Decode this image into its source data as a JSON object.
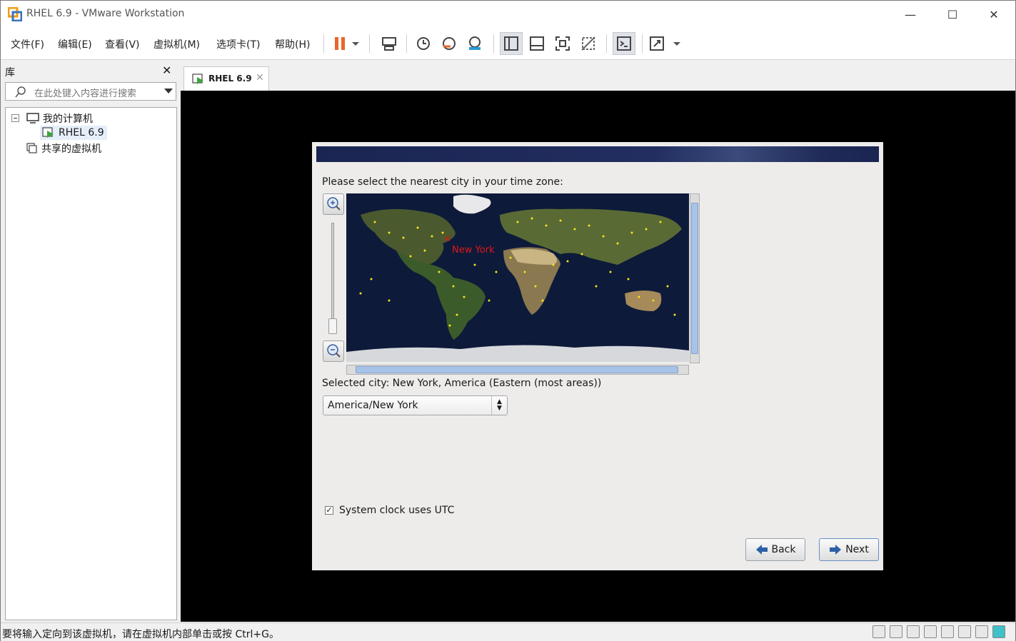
{
  "window": {
    "title": "RHEL 6.9 - VMware Workstation"
  },
  "menu": [
    "文件(F)",
    "编辑(E)",
    "查看(V)",
    "虚拟机(M)",
    "选项卡(T)",
    "帮助(H)"
  ],
  "library": {
    "title": "库",
    "search_placeholder": "在此处键入内容进行搜索",
    "tree": {
      "my_computer": "我的计算机",
      "vm": "RHEL 6.9",
      "shared": "共享的虚拟机"
    }
  },
  "tab": {
    "label": "RHEL 6.9"
  },
  "installer": {
    "prompt": "Please select the nearest city in your time zone:",
    "map_marker_label": "New York",
    "selected_city": "Selected city: New York, America (Eastern (most areas))",
    "timezone_value": "America/New York",
    "utc_label": "System clock uses UTC",
    "utc_checked": true,
    "back_label": "Back",
    "next_label": "Next"
  },
  "status": {
    "text": "要将输入定向到该虚拟机，请在虚拟机内部单击或按 Ctrl+G。"
  },
  "colors": {
    "accent_orange": "#e8672a",
    "selection": "#e5eef9",
    "banner": "#1a2552"
  }
}
